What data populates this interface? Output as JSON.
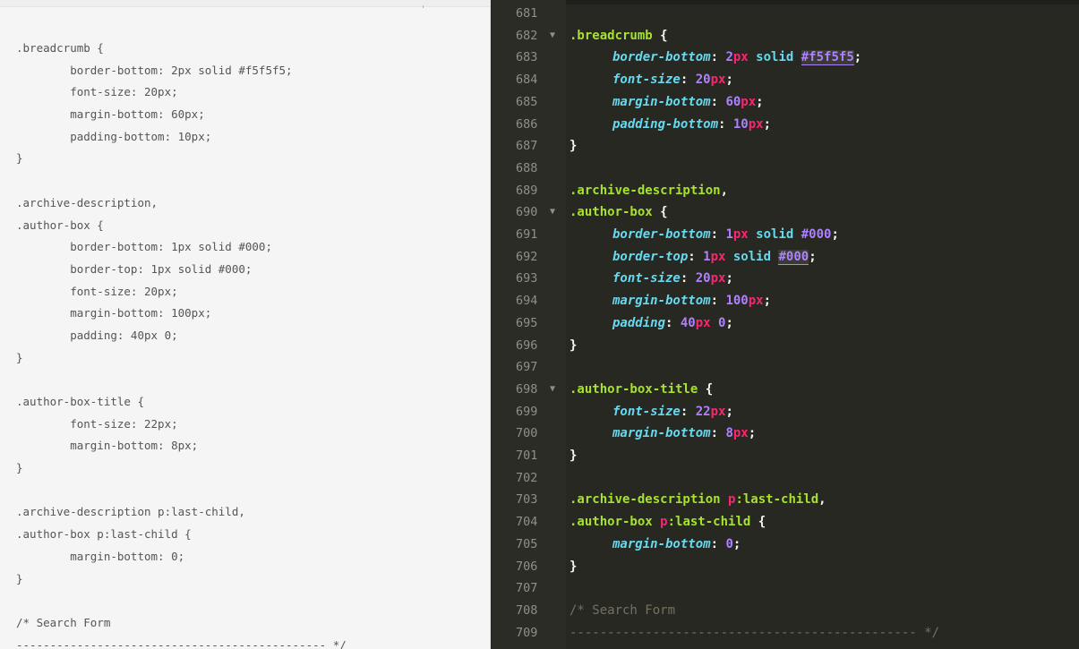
{
  "plain_lines": [
    ".breadcrumb {",
    "        border-bottom: 2px solid #f5f5f5;",
    "        font-size: 20px;",
    "        margin-bottom: 60px;",
    "        padding-bottom: 10px;",
    "}",
    "",
    ".archive-description,",
    ".author-box {",
    "        border-bottom: 1px solid #000;",
    "        border-top: 1px solid #000;",
    "        font-size: 20px;",
    "        margin-bottom: 100px;",
    "        padding: 40px 0;",
    "}",
    "",
    ".author-box-title {",
    "        font-size: 22px;",
    "        margin-bottom: 8px;",
    "}",
    "",
    ".archive-description p:last-child,",
    ".author-box p:last-child {",
    "        margin-bottom: 0;",
    "}",
    "",
    "/* Search Form",
    "---------------------------------------------- */"
  ],
  "editor": {
    "lines": [
      {
        "n": "681",
        "fold": "",
        "tokens": []
      },
      {
        "n": "682",
        "fold": "▼",
        "tokens": [
          {
            "t": ".breadcrumb",
            "c": "sel"
          },
          {
            "t": " {",
            "c": "pun"
          }
        ]
      },
      {
        "n": "683",
        "fold": "",
        "indent": true,
        "tokens": [
          {
            "t": "border-bottom",
            "c": "prop"
          },
          {
            "t": ": ",
            "c": "pun"
          },
          {
            "t": "2",
            "c": "num"
          },
          {
            "t": "px",
            "c": "unit"
          },
          {
            "t": " solid ",
            "c": "kw"
          },
          {
            "t": "#f5f5f5",
            "c": "hexu"
          },
          {
            "t": ";",
            "c": "pun"
          }
        ]
      },
      {
        "n": "684",
        "fold": "",
        "indent": true,
        "tokens": [
          {
            "t": "font-size",
            "c": "prop"
          },
          {
            "t": ": ",
            "c": "pun"
          },
          {
            "t": "20",
            "c": "num"
          },
          {
            "t": "px",
            "c": "unit"
          },
          {
            "t": ";",
            "c": "pun"
          }
        ]
      },
      {
        "n": "685",
        "fold": "",
        "indent": true,
        "tokens": [
          {
            "t": "margin-bottom",
            "c": "prop"
          },
          {
            "t": ": ",
            "c": "pun"
          },
          {
            "t": "60",
            "c": "num"
          },
          {
            "t": "px",
            "c": "unit"
          },
          {
            "t": ";",
            "c": "pun"
          }
        ]
      },
      {
        "n": "686",
        "fold": "",
        "indent": true,
        "tokens": [
          {
            "t": "padding-bottom",
            "c": "prop"
          },
          {
            "t": ": ",
            "c": "pun"
          },
          {
            "t": "10",
            "c": "num"
          },
          {
            "t": "px",
            "c": "unit"
          },
          {
            "t": ";",
            "c": "pun"
          }
        ]
      },
      {
        "n": "687",
        "fold": "",
        "tokens": [
          {
            "t": "}",
            "c": "pun"
          }
        ]
      },
      {
        "n": "688",
        "fold": "",
        "tokens": []
      },
      {
        "n": "689",
        "fold": "",
        "tokens": [
          {
            "t": ".archive-description",
            "c": "sel"
          },
          {
            "t": ",",
            "c": "pun"
          }
        ]
      },
      {
        "n": "690",
        "fold": "▼",
        "tokens": [
          {
            "t": ".author-box",
            "c": "sel"
          },
          {
            "t": " {",
            "c": "pun"
          }
        ]
      },
      {
        "n": "691",
        "fold": "",
        "indent": true,
        "tokens": [
          {
            "t": "border-bottom",
            "c": "prop"
          },
          {
            "t": ": ",
            "c": "pun"
          },
          {
            "t": "1",
            "c": "num"
          },
          {
            "t": "px",
            "c": "unit"
          },
          {
            "t": " solid ",
            "c": "kw"
          },
          {
            "t": "#000",
            "c": "hex"
          },
          {
            "t": ";",
            "c": "pun"
          }
        ]
      },
      {
        "n": "692",
        "fold": "",
        "indent": true,
        "tokens": [
          {
            "t": "border-top",
            "c": "prop"
          },
          {
            "t": ": ",
            "c": "pun"
          },
          {
            "t": "1",
            "c": "num"
          },
          {
            "t": "px",
            "c": "unit"
          },
          {
            "t": " solid ",
            "c": "kw"
          },
          {
            "t": "#000",
            "c": "hexu"
          },
          {
            "t": ";",
            "c": "pun"
          }
        ]
      },
      {
        "n": "693",
        "fold": "",
        "indent": true,
        "tokens": [
          {
            "t": "font-size",
            "c": "prop"
          },
          {
            "t": ": ",
            "c": "pun"
          },
          {
            "t": "20",
            "c": "num"
          },
          {
            "t": "px",
            "c": "unit"
          },
          {
            "t": ";",
            "c": "pun"
          }
        ]
      },
      {
        "n": "694",
        "fold": "",
        "indent": true,
        "tokens": [
          {
            "t": "margin-bottom",
            "c": "prop"
          },
          {
            "t": ": ",
            "c": "pun"
          },
          {
            "t": "100",
            "c": "num"
          },
          {
            "t": "px",
            "c": "unit"
          },
          {
            "t": ";",
            "c": "pun"
          }
        ]
      },
      {
        "n": "695",
        "fold": "",
        "indent": true,
        "tokens": [
          {
            "t": "padding",
            "c": "prop"
          },
          {
            "t": ": ",
            "c": "pun"
          },
          {
            "t": "40",
            "c": "num"
          },
          {
            "t": "px",
            "c": "unit"
          },
          {
            "t": " ",
            "c": "pun"
          },
          {
            "t": "0",
            "c": "num"
          },
          {
            "t": ";",
            "c": "pun"
          }
        ]
      },
      {
        "n": "696",
        "fold": "",
        "tokens": [
          {
            "t": "}",
            "c": "pun"
          }
        ]
      },
      {
        "n": "697",
        "fold": "",
        "tokens": []
      },
      {
        "n": "698",
        "fold": "▼",
        "tokens": [
          {
            "t": ".author-box-title",
            "c": "sel"
          },
          {
            "t": " {",
            "c": "pun"
          }
        ]
      },
      {
        "n": "699",
        "fold": "",
        "indent": true,
        "tokens": [
          {
            "t": "font-size",
            "c": "prop"
          },
          {
            "t": ": ",
            "c": "pun"
          },
          {
            "t": "22",
            "c": "num"
          },
          {
            "t": "px",
            "c": "unit"
          },
          {
            "t": ";",
            "c": "pun"
          }
        ]
      },
      {
        "n": "700",
        "fold": "",
        "indent": true,
        "tokens": [
          {
            "t": "margin-bottom",
            "c": "prop"
          },
          {
            "t": ": ",
            "c": "pun"
          },
          {
            "t": "8",
            "c": "num"
          },
          {
            "t": "px",
            "c": "unit"
          },
          {
            "t": ";",
            "c": "pun"
          }
        ]
      },
      {
        "n": "701",
        "fold": "",
        "tokens": [
          {
            "t": "}",
            "c": "pun"
          }
        ]
      },
      {
        "n": "702",
        "fold": "",
        "tokens": []
      },
      {
        "n": "703",
        "fold": "",
        "tokens": [
          {
            "t": ".archive-description ",
            "c": "sel"
          },
          {
            "t": "p",
            "c": "pseudo"
          },
          {
            "t": ":last-child",
            "c": "sel"
          },
          {
            "t": ",",
            "c": "pun"
          }
        ]
      },
      {
        "n": "704",
        "fold": "",
        "tokens": [
          {
            "t": ".author-box ",
            "c": "sel"
          },
          {
            "t": "p",
            "c": "pseudo"
          },
          {
            "t": ":last-child",
            "c": "sel"
          },
          {
            "t": " {",
            "c": "pun"
          }
        ]
      },
      {
        "n": "705",
        "fold": "",
        "indent": true,
        "tokens": [
          {
            "t": "margin-bottom",
            "c": "prop"
          },
          {
            "t": ": ",
            "c": "pun"
          },
          {
            "t": "0",
            "c": "num"
          },
          {
            "t": ";",
            "c": "pun"
          }
        ]
      },
      {
        "n": "706",
        "fold": "",
        "tokens": [
          {
            "t": "}",
            "c": "pun"
          }
        ]
      },
      {
        "n": "707",
        "fold": "",
        "tokens": []
      },
      {
        "n": "708",
        "fold": "",
        "tokens": [
          {
            "t": "/* Search Form",
            "c": "com"
          }
        ]
      },
      {
        "n": "709",
        "fold": "",
        "tokens": [
          {
            "t": "---------------------------------------------- */",
            "c": "com"
          }
        ]
      }
    ]
  },
  "colors": {
    "editor_bg": "#272822",
    "plain_bg": "#f5f5f5",
    "selector": "#a6e22e",
    "property": "#66d9ef",
    "number": "#ae81ff",
    "unit": "#f92672",
    "comment": "#75715e"
  }
}
